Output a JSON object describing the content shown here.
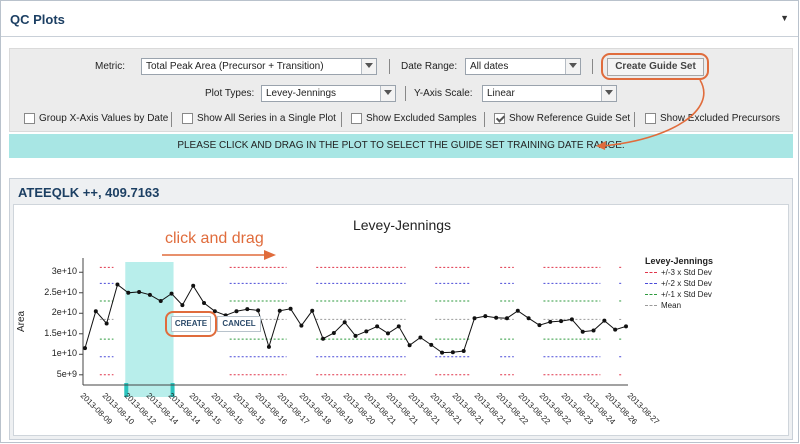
{
  "header": {
    "title": "QC Plots"
  },
  "controls": {
    "metric_label": "Metric:",
    "metric_value": "Total Peak Area (Precursor + Transition)",
    "date_range_label": "Date Range:",
    "date_range_value": "All dates",
    "create_guide_set": "Create Guide Set",
    "plot_types_label": "Plot Types:",
    "plot_types_value": "Levey-Jennings",
    "y_axis_scale_label": "Y-Axis Scale:",
    "y_axis_scale_value": "Linear",
    "checkboxes": [
      {
        "label": "Group X-Axis Values by Date",
        "checked": false
      },
      {
        "label": "Show All Series in a Single Plot",
        "checked": false
      },
      {
        "label": "Show Excluded Samples",
        "checked": false
      },
      {
        "label": "Show Reference Guide Set",
        "checked": true
      },
      {
        "label": "Show Excluded Precursors",
        "checked": false
      }
    ]
  },
  "banner": {
    "text": "PLEASE CLICK AND DRAG IN THE PLOT TO SELECT THE GUIDE SET TRAINING DATE RANGE."
  },
  "panel": {
    "title": "ATEEQLK ++, 409.7163"
  },
  "annotation": {
    "text": "click and drag"
  },
  "brush": {
    "create": "CREATE",
    "cancel": "CANCEL",
    "start_index": 4,
    "end_index": 8
  },
  "colors": {
    "accent": "#e06c3c",
    "banner": "#a8e6e4",
    "brush": "#a0e8e4",
    "brush_handle": "#2cc4be",
    "sd3": "#e0344a",
    "sd2": "#4a4ad8",
    "sd1": "#2e9a3e",
    "mean": "#9a9a9a"
  },
  "chart_data": {
    "type": "line",
    "title": "Levey-Jennings",
    "ylabel": "Area",
    "xlabel": "",
    "ylim": [
      3000000000,
      32500000000
    ],
    "yticks": [
      5000000000,
      10000000000,
      15000000000,
      20000000000,
      25000000000,
      30000000000
    ],
    "ytick_labels": [
      "5e+9",
      "1e+10",
      "1.5e+10",
      "2e+10",
      "2.5e+10",
      "3e+10"
    ],
    "x": [
      "2013-08-09",
      "2013-08-10",
      "2013-08-12",
      "2013-08-14",
      "2013-08-14",
      "2013-08-15",
      "2013-08-15",
      "2013-08-15",
      "2013-08-16",
      "2013-08-17",
      "2013-08-18",
      "2013-08-19",
      "2013-08-20",
      "2013-08-21",
      "2013-08-21",
      "2013-08-21",
      "2013-08-21",
      "2013-08-21",
      "2013-08-21",
      "2013-08-22",
      "2013-08-22",
      "2013-08-22",
      "2013-08-23",
      "2013-08-24",
      "2013-08-26",
      "2013-08-27"
    ],
    "series": [
      {
        "values": [
          11500000000,
          20500000000,
          17500000000,
          27000000000,
          25000000000,
          25200000000,
          24500000000,
          23000000000,
          24800000000,
          22000000000,
          26700000000,
          22500000000,
          20500000000,
          19500000000,
          20500000000,
          21000000000,
          20700000000,
          11800000000,
          20600000000,
          21100000000,
          17000000000,
          20600000000,
          13800000000,
          15200000000,
          17800000000,
          14500000000,
          15600000000,
          16800000000,
          15100000000,
          16800000000,
          12200000000,
          14100000000,
          12300000000,
          10400000000,
          10500000000,
          10800000000,
          18800000000,
          19300000000,
          18900000000,
          18800000000,
          20600000000,
          18800000000,
          17100000000,
          17900000000,
          18100000000,
          18500000000,
          15500000000,
          15800000000,
          18200000000,
          16000000000,
          16800000000
        ]
      }
    ],
    "reference_lines": [
      {
        "name": "+/-3 x Std Dev",
        "values": [
          31200000000,
          5000000000
        ]
      },
      {
        "name": "+/-2 x Std Dev",
        "values": [
          27300000000,
          9400000000
        ]
      },
      {
        "name": "+/-1 x Std Dev",
        "values": [
          23000000000,
          13700000000
        ]
      },
      {
        "name": "Mean",
        "values": [
          18500000000
        ]
      }
    ],
    "legend": {
      "title": "Levey-Jennings",
      "position": "right"
    }
  }
}
